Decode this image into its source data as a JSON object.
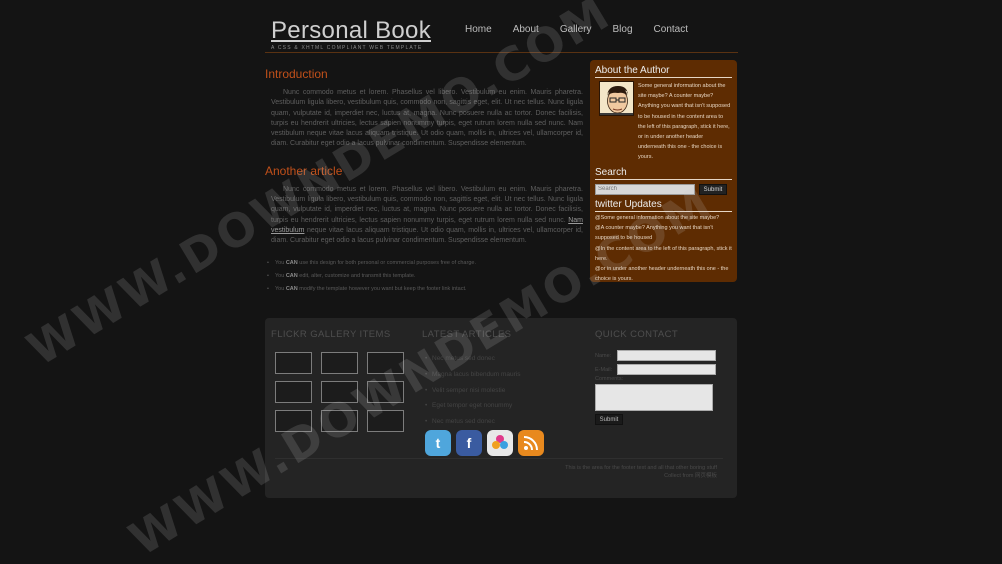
{
  "header": {
    "logo": "Personal Book",
    "tagline": "A css & xhtml compliant web template"
  },
  "nav": [
    "Home",
    "About",
    "Gallery",
    "Blog",
    "Contact"
  ],
  "articles": [
    {
      "title": "Introduction",
      "body": "Nunc commodo metus et lorem. Phasellus vel libero. Vestibulum eu enim. Mauris pharetra. Vestibulum ligula libero, vestibulum quis, commodo non, sagittis eget, elit. Ut nec tellus. Nunc ligula quam, vulputate id, imperdiet nec, luctus at, magna. Nunc posuere nulla ac tortor. Donec facilisis, turpis eu hendrerit ultricies, lectus sapien nonummy turpis, eget rutrum lorem nulla sed nunc. Nam vestibulum neque vitae lacus aliquam tristique. Ut odio quam, mollis in, ultrices vel, ullamcorper id, diam. Curabitur eget odio a lacus pulvinar condimentum. Suspendisse elementum."
    },
    {
      "title": "Another article",
      "body_before": "Nunc commodo metus et lorem. Phasellus vel libero. Vestibulum eu enim. Mauris pharetra. Vestibulum ligula libero, vestibulum quis, commodo non, sagittis eget, elit. Ut nec tellus. Nunc ligula quam, vulputate id, imperdiet nec, luctus at, magna. Nunc posuere nulla ac tortor. Donec facilisis, turpis eu hendrerit ultricies, lectus sapien nonummy turpis, eget rutrum lorem nulla sed nunc. ",
      "link": "Nam vestibulum",
      "body_after": " neque vitae lacus aliquam tristique. Ut odio quam, mollis in, ultrices vel, ullamcorper id, diam. Curabitur eget odio a lacus pulvinar condimentum. Suspendisse elementum."
    }
  ],
  "bullets": [
    {
      "strong": "CAN",
      "pre": "You ",
      "text": " use this design for both personal or commercial purposes free of charge."
    },
    {
      "strong": "CAN",
      "pre": "You ",
      "text": " edit, alter, customize and transmit this template."
    },
    {
      "strong": "CAN",
      "pre": "You ",
      "text": " modify the template however you want but keep the footer link intact."
    }
  ],
  "sidebar": {
    "author_title": "About the Author",
    "author_text": "Some general information about the site maybe? A counter maybe? Anything you want that isn't supposed to be housed in the content area to the left of this paragraph, stick it here, or in under another header underneath this one - the choice is yours.",
    "search_title": "Search",
    "search_placeholder": "Search",
    "search_button": "Submit",
    "twitter_title": "twitter Updates",
    "tweets": [
      "@Some general information about the site maybe?",
      "@A counter maybe? Anything you want that isn't supposed to be housed",
      "@In the content area to the left of this paragraph, stick it here.",
      "@or in under another header underneath this one - the choice is yours."
    ]
  },
  "footer": {
    "flickr_title": "FLICKR GALLERY ITEMS",
    "articles_title": "LATEST ARTICLES",
    "latest_articles": [
      "Nec metus sed donec",
      "Magna lacus bibendum mauris",
      "Velit semper nisi molestie",
      "Eget tempor eget nonummy",
      "Nec metus sed donec"
    ],
    "contact_title": "QUICK CONTACT",
    "name_label": "Name:",
    "email_label": "E-Mail:",
    "comments_label": "Comments:",
    "submit_label": "Submit",
    "footer_line1": "This is the area for the footer text and all that other boring stuff",
    "footer_line2": "Collect from 网页模板"
  },
  "social": [
    {
      "name": "twitter-icon",
      "glyph": "t",
      "color": "#4fa6dc"
    },
    {
      "name": "facebook-icon",
      "glyph": "f",
      "color": "#3a5ba0"
    },
    {
      "name": "flickr-icon",
      "glyph": "✿",
      "color": "#cfcfcf"
    },
    {
      "name": "rss-icon",
      "glyph": "))",
      "color": "#e8891e"
    }
  ],
  "watermark": "WWW.DOWNDEMO.COM"
}
